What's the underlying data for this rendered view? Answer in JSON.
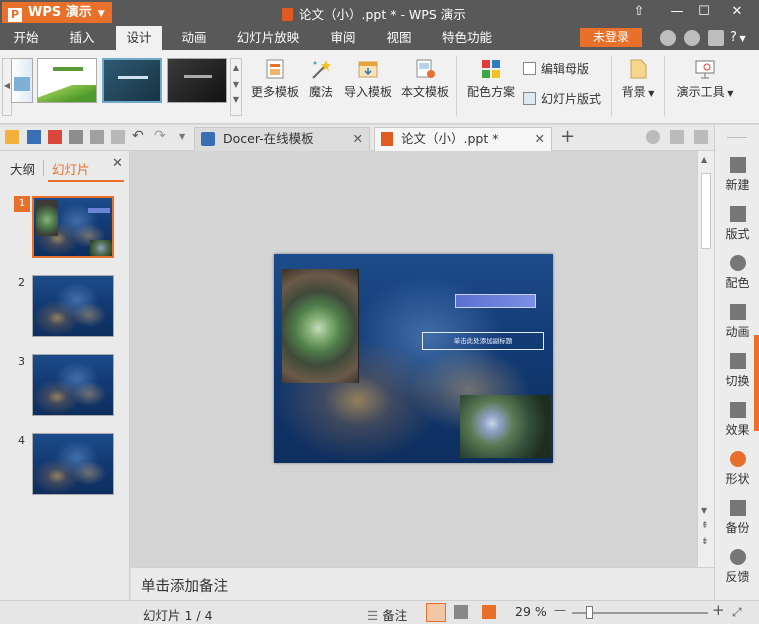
{
  "app": {
    "logo_text": "WPS 演示",
    "logo_letter": "P",
    "doc_title": "论文（小）.ppt * - WPS 演示"
  },
  "window_controls": {
    "restore": "⇧",
    "minimize": "—",
    "maximize": "☐",
    "close": "✕"
  },
  "menu": {
    "items": [
      "开始",
      "插入",
      "设计",
      "动画",
      "幻灯片放映",
      "审阅",
      "视图",
      "特色功能"
    ],
    "active": "设计",
    "login_label": "未登录",
    "help": "?"
  },
  "ribbon": {
    "more_templates": "更多模板",
    "magic": "魔法",
    "import_template": "导入模板",
    "this_template": "本文模板",
    "color_scheme": "配色方案",
    "edit_master": "编辑母版",
    "slide_layout": "幻灯片版式",
    "background": "背景",
    "present_tools": "演示工具"
  },
  "tabs": [
    {
      "label": "Docer-在线模板",
      "close": "✕"
    },
    {
      "label": "论文（小）.ppt *",
      "close": "✕"
    }
  ],
  "new_tab": "+",
  "left_panel": {
    "tab_outline": "大纲",
    "tab_slides": "幻灯片",
    "close": "✕",
    "slide_numbers": [
      "1",
      "2",
      "3",
      "4"
    ]
  },
  "slide": {
    "subtitle_placeholder": "单击此处添加副标题"
  },
  "notes_placeholder": "单击添加备注",
  "right_sidebar": [
    "新建",
    "版式",
    "配色",
    "动画",
    "切换",
    "效果",
    "形状",
    "备份",
    "反馈"
  ],
  "status": {
    "slide_indicator": "幻灯片 1 / 4",
    "notes": "备注",
    "zoom": "29 %",
    "zoom_level": 0.29,
    "zoom_minus": "—",
    "zoom_plus": "+"
  },
  "colors": {
    "accent": "#e8702a",
    "titlebar": "#595959",
    "slide_blue": "#123a74"
  }
}
